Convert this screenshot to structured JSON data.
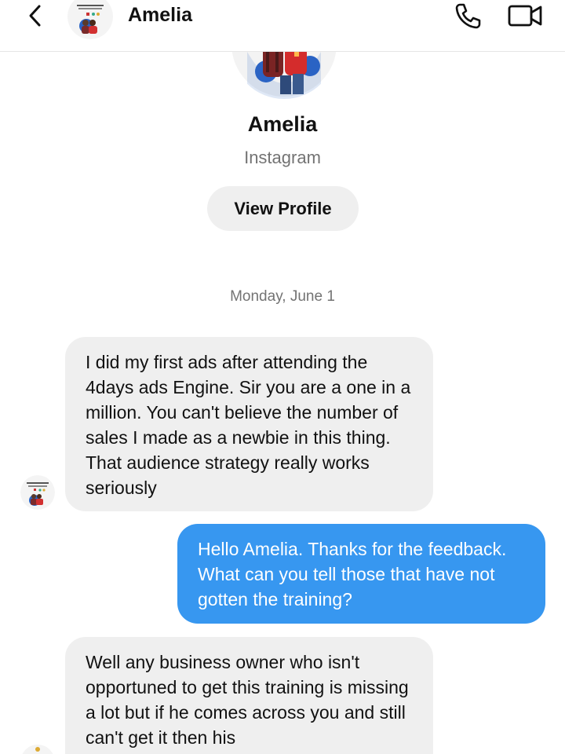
{
  "header": {
    "name": "Amelia",
    "icons": {
      "back": "chevron-left-icon",
      "call": "phone-icon",
      "video": "video-camera-icon"
    }
  },
  "profile": {
    "name": "Amelia",
    "source": "Instagram",
    "view_profile_label": "View Profile"
  },
  "thread": {
    "date": "Monday, June 1",
    "messages": [
      {
        "sender": "contact",
        "text": "I did my first ads after attending the 4days ads Engine. Sir you are a one in a million. You can't believe the number of sales I made as a newbie in this thing. That audience strategy really works seriously"
      },
      {
        "sender": "me",
        "text": "Hello Amelia. Thanks for the feedback. What can you tell those that have not gotten the training?"
      },
      {
        "sender": "contact",
        "text": "Well any business owner who isn't opportuned to get this training is missing a lot but if he comes across you and still can't get it then his"
      }
    ]
  },
  "colors": {
    "outgoing_bubble": "#3797f0",
    "incoming_bubble": "#efefef",
    "secondary_text": "#737373"
  }
}
